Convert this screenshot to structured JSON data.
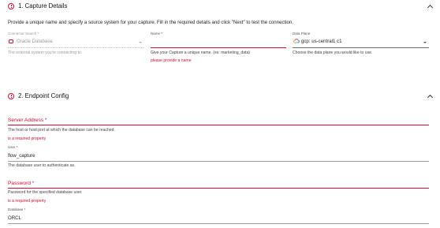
{
  "capture_details": {
    "title": "1. Capture Details",
    "intro": "Provide a unique name and specify a source system for your capture. Fill in the required details and click \"Next\" to test the connection.",
    "connector": {
      "label": "Connector Search *",
      "value": "Oracle Database",
      "helper": "The external system you're connecting to."
    },
    "name": {
      "label": "Name *",
      "helper": "Give your Capture a unique name. (ex: marketing_data)",
      "error": "please provide a name"
    },
    "data_plane": {
      "label": "Data Plane",
      "value": "gcp: us-central1 c1",
      "helper": "Choose the data plane you would like to use."
    }
  },
  "endpoint_config": {
    "title": "2. Endpoint Config",
    "server_address": {
      "label": "Server Address *",
      "helper": "The host or host:port at which the database can be reached.",
      "error": "is a required property"
    },
    "user": {
      "label": "User *",
      "value": "flow_capture",
      "helper": "The database user to authenticate as."
    },
    "password": {
      "label": "Password *",
      "helper": "Password for the specified database user.",
      "error": "is a required property"
    },
    "database": {
      "label": "Database *",
      "value": "ORCL"
    }
  },
  "colors": {
    "error": "#c8102e",
    "text": "#1a1a1a",
    "helper": "#444444",
    "disabled": "#9a9a9a"
  },
  "icons": {
    "section_status": "error-circle-icon",
    "collapse": "chevron-up-icon",
    "connector": "oracle-database-icon",
    "data_plane": "gcp-cloud-icon",
    "dropdown": "caret-down-icon"
  }
}
